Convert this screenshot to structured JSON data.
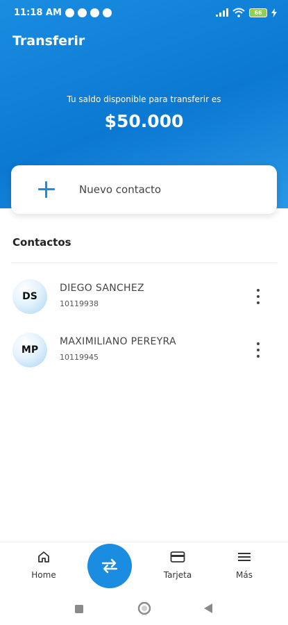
{
  "status_bar": {
    "time": "11:18 AM",
    "battery": "66"
  },
  "header": {
    "title": "Transferir"
  },
  "balance": {
    "label": "Tu saldo disponible para transferir es",
    "amount": "$50.000"
  },
  "new_contact": {
    "label": "Nuevo contacto",
    "icon": "plus-icon"
  },
  "contacts": {
    "title": "Contactos",
    "items": [
      {
        "initials": "DS",
        "name": "DIEGO SANCHEZ",
        "account": "10119938"
      },
      {
        "initials": "MP",
        "name": "MAXIMILIANO PEREYRA",
        "account": "10119945"
      }
    ]
  },
  "bottom_nav": {
    "items": [
      {
        "label": "Home",
        "icon": "home-icon"
      },
      {
        "label": "Tarjeta",
        "icon": "card-icon"
      },
      {
        "label": "Más",
        "icon": "menu-icon"
      }
    ],
    "fab_icon": "transfer-arrows-icon"
  },
  "colors": {
    "primary": "#1a8de0",
    "text": "#222222"
  }
}
